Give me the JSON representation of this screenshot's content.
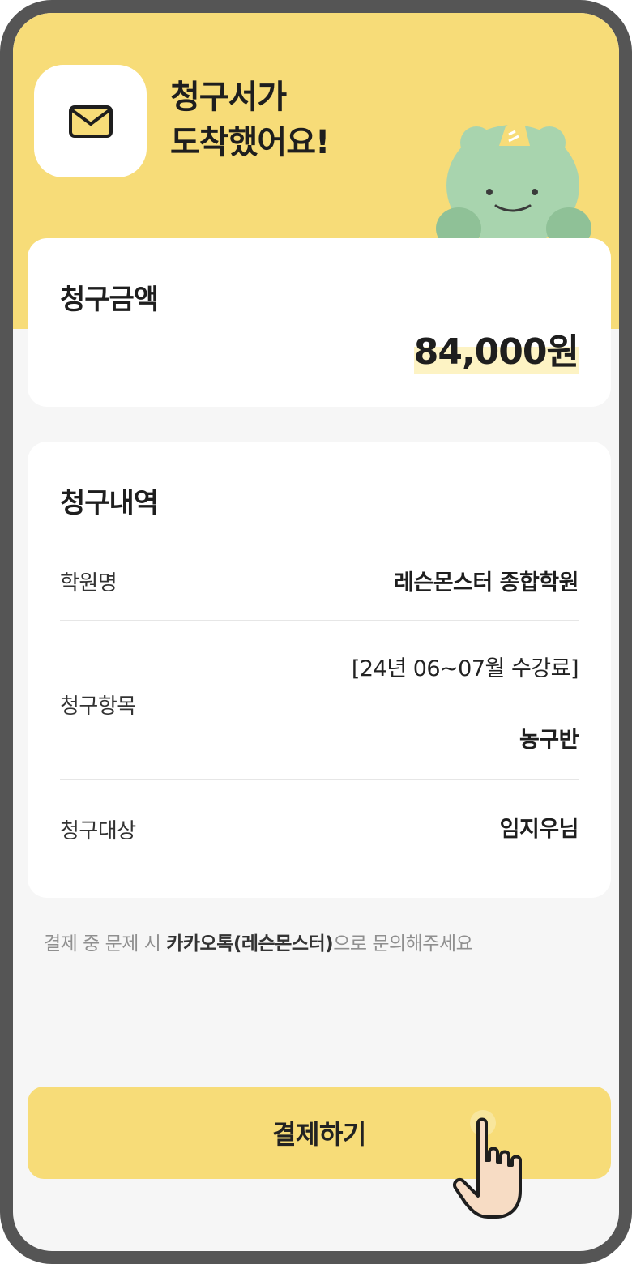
{
  "header": {
    "title_line1": "청구서가",
    "title_line2": "도착했어요!"
  },
  "amount_card": {
    "title": "청구금액",
    "amount": "84,000원"
  },
  "detail_card": {
    "title": "청구내역",
    "rows": [
      {
        "label": "학원명",
        "value": "레슨몬스터 종합학원"
      },
      {
        "label": "청구항목",
        "value_line1": "[24년 06~07월 수강료]",
        "value_line2": "농구반"
      },
      {
        "label": "청구대상",
        "value": "임지우님"
      }
    ]
  },
  "notice": {
    "prefix": "결제 중 문제 시 ",
    "highlight": "카카오톡(레슨몬스터)",
    "suffix": "으로 문의해주세요"
  },
  "pay_button": {
    "label": "결제하기"
  },
  "colors": {
    "accent": "#f7dc78",
    "amount_highlight": "#fdf3c4",
    "mascot": "#a8d4ae",
    "background": "#f6f6f6"
  },
  "icons": {
    "envelope": "envelope-icon",
    "mascot": "frog-mascot",
    "pointer": "hand-pointer-icon"
  }
}
